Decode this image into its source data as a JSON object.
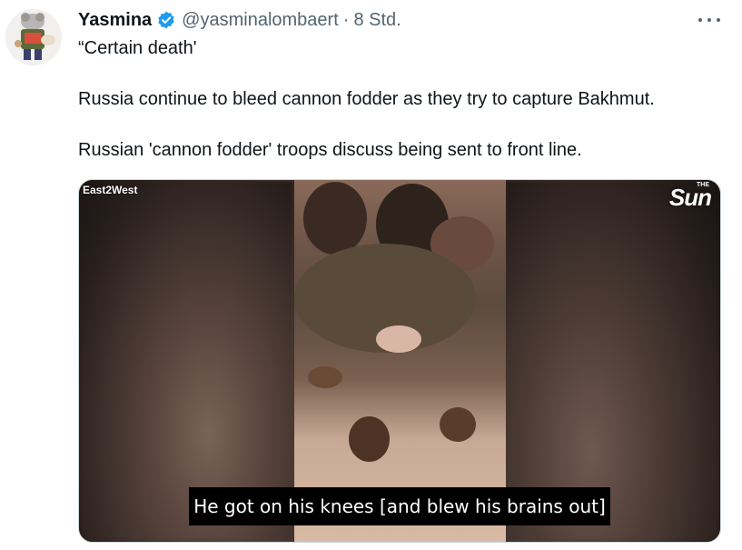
{
  "post": {
    "author_name": "Yasmina",
    "handle": "@yasminalombaert",
    "separator": "·",
    "time": "8 Std.",
    "lines": [
      "“Certain death'",
      "Russia continue to bleed cannon fodder as they try to capture Bakhmut.",
      "Russian 'cannon fodder' troops discuss being sent to front line."
    ]
  },
  "media": {
    "watermark_left": "East2West",
    "watermark_right": "Sun",
    "watermark_right_prefix": "THE",
    "subtitle": "He got on his knees [and blew his brains out]"
  },
  "colors": {
    "verified": "#1d9bf0",
    "secondary_text": "#536471",
    "primary_text": "#0f1419"
  },
  "icons": {
    "verified": "verified-badge-icon",
    "more": "more-options-icon"
  }
}
